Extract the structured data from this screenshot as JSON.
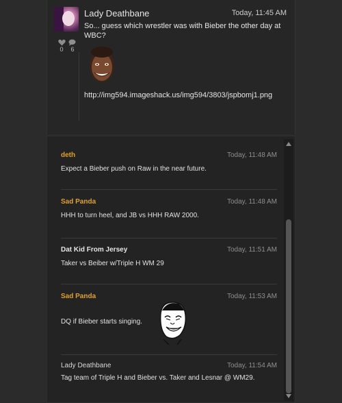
{
  "post": {
    "author": "Lady Deathbane",
    "time": "Today, 11:45 AM",
    "text": "So... guess which wrestler was with Bieber the other day at WBC?",
    "link": "http://img594.imageshack.us/img594/3803/jspbomj1.png",
    "likes": "0",
    "comments": "6"
  },
  "comments": [
    {
      "author": "deth",
      "time": "Today, 11:48 AM",
      "text": "Expect a Bieber push on Raw in the near future."
    },
    {
      "author": "Sad Panda",
      "time": "Today, 11:48 AM",
      "text": "HHH to turn heel, and JB vs HHH RAW 2000."
    },
    {
      "author": "Dat Kid From Jersey",
      "time": "Today, 11:51 AM",
      "text": "Taker vs Beiber w/Triple H WM 29"
    },
    {
      "author": "Sad Panda",
      "time": "Today, 11:53 AM",
      "text": "DQ if Bieber starts singing."
    },
    {
      "author": "Lady Deathbane",
      "time": "Today, 11:54 AM",
      "text": "Tag team of Triple H and Bieber vs. Taker and Lesnar @ WM29."
    }
  ],
  "colors": {
    "accent_name": "#e0a12a",
    "background": "#2b2b2b",
    "panel": "#232323"
  }
}
